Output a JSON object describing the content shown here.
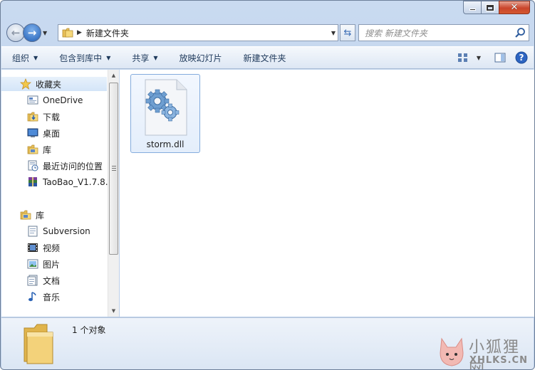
{
  "titlebar": {
    "minimize_label": "",
    "maximize_label": "",
    "close_glyph": "✕"
  },
  "address": {
    "crumb": "新建文件夹"
  },
  "search": {
    "placeholder": "搜索 新建文件夹"
  },
  "toolbar": {
    "items": [
      {
        "label": "组织",
        "has_dropdown": true
      },
      {
        "label": "包含到库中",
        "has_dropdown": true
      },
      {
        "label": "共享",
        "has_dropdown": true
      },
      {
        "label": "放映幻灯片",
        "has_dropdown": false
      },
      {
        "label": "新建文件夹",
        "has_dropdown": false
      }
    ],
    "right_icons": [
      "change-view-icon",
      "view-dropdown-icon",
      "preview-pane-icon",
      "help-icon"
    ]
  },
  "navpane": {
    "favorites": {
      "label": "收藏夹",
      "icon": "star-icon",
      "items": [
        {
          "label": "OneDrive",
          "icon": "onedrive-icon"
        },
        {
          "label": "下载",
          "icon": "downloads-icon"
        },
        {
          "label": "桌面",
          "icon": "desktop-icon"
        },
        {
          "label": "库",
          "icon": "library-icon"
        },
        {
          "label": "最近访问的位置",
          "icon": "recent-places-icon"
        },
        {
          "label": "TaoBao_V1.7.8.",
          "icon": "winrar-icon"
        }
      ]
    },
    "libraries": {
      "label": "库",
      "icon": "library-icon",
      "items": [
        {
          "label": "Subversion",
          "icon": "subversion-icon"
        },
        {
          "label": "视频",
          "icon": "videos-icon"
        },
        {
          "label": "图片",
          "icon": "pictures-icon"
        },
        {
          "label": "文档",
          "icon": "documents-icon"
        },
        {
          "label": "音乐",
          "icon": "music-icon"
        }
      ]
    }
  },
  "files": [
    {
      "name": "storm.dll",
      "icon": "dll-gears-icon",
      "selected": true
    }
  ],
  "details": {
    "count_text": "1 个对象"
  },
  "watermark": {
    "text_cn": "小狐狸网",
    "text_en": "XHLKS.CN"
  },
  "colors": {
    "accent": "#1f5eb6",
    "selection_border": "#84acdd",
    "toolbar_text": "#1e395b"
  }
}
